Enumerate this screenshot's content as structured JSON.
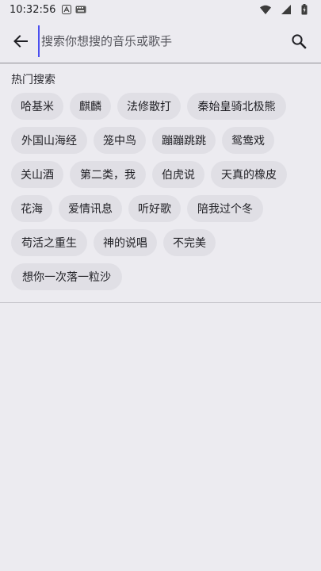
{
  "status_bar": {
    "time": "10:32:56"
  },
  "search": {
    "placeholder": "搜索你想搜的音乐或歌手",
    "value": ""
  },
  "hot": {
    "title": "热门搜索",
    "rows": [
      [
        "哈基米",
        "麒麟",
        "法修散打",
        "秦始皇骑北极熊"
      ],
      [
        "外国山海经",
        "笼中鸟",
        "蹦蹦跳跳",
        "鸳鸯戏"
      ],
      [
        "关山酒",
        "第二类，我",
        "伯虎说",
        "天真的橡皮"
      ],
      [
        "花海",
        "爱情讯息",
        "听好歌",
        "陪我过个冬"
      ],
      [
        "苟活之重生",
        "神的说唱",
        "不完美"
      ],
      [
        "想你一次落一粒沙"
      ]
    ]
  }
}
